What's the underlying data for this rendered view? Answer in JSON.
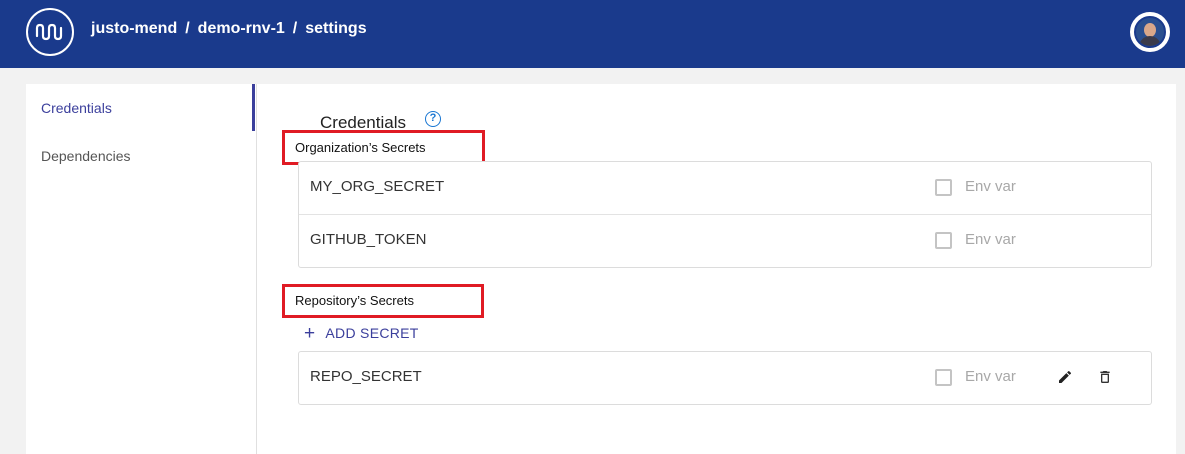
{
  "header": {
    "logo_icon": "wave-logo-icon",
    "breadcrumb": [
      "justo-mend",
      "demo-rnv-1",
      "settings"
    ],
    "separator": "/",
    "avatar_icon": "user-avatar-icon"
  },
  "sidebar": {
    "items": [
      {
        "label": "Credentials",
        "active": true
      },
      {
        "label": "Dependencies",
        "active": false
      }
    ]
  },
  "main": {
    "title": "Credentials",
    "help_icon": "help-circle-icon",
    "org_section": {
      "label": "Organization’s Secrets",
      "rows": [
        {
          "name": "MY_ORG_SECRET",
          "env_label": "Env var",
          "checked": false
        },
        {
          "name": "GITHUB_TOKEN",
          "env_label": "Env var",
          "checked": false
        }
      ]
    },
    "repo_section": {
      "label": "Repository’s Secrets",
      "add_button": "ADD SECRET",
      "rows": [
        {
          "name": "REPO_SECRET",
          "env_label": "Env var",
          "checked": false,
          "edit_icon": "pencil-icon",
          "delete_icon": "trash-icon"
        }
      ]
    }
  },
  "colors": {
    "header_bg": "#1a3a8c",
    "accent": "#3b3f9c",
    "highlight_box": "#e01b24",
    "help": "#1976d2"
  }
}
